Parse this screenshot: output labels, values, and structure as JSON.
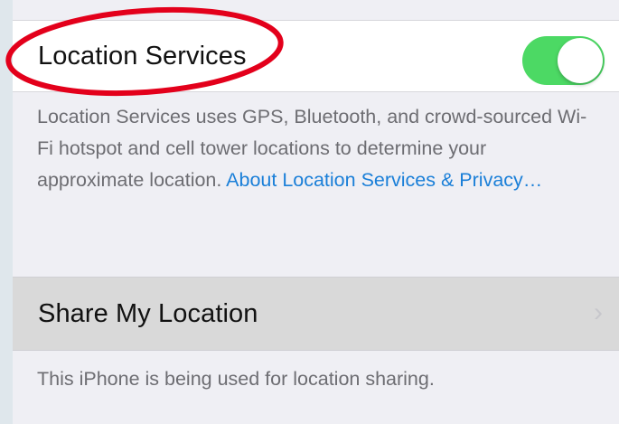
{
  "location_services": {
    "label": "Location Services",
    "toggle_on": true,
    "toggle_color": "#4cd964"
  },
  "description": {
    "text": "Location Services uses GPS, Bluetooth, and crowd-sourced Wi-Fi hotspot and cell tower locations to determine your approximate location. ",
    "link_text": "About Location Services & Privacy…",
    "link_color": "#1a7fd8"
  },
  "share_my_location": {
    "label": "Share My Location",
    "chevron_icon": "chevron-right-icon",
    "footer": "This iPhone is being used for location sharing."
  },
  "annotation": {
    "shape": "ellipse",
    "color": "#e3001b"
  }
}
